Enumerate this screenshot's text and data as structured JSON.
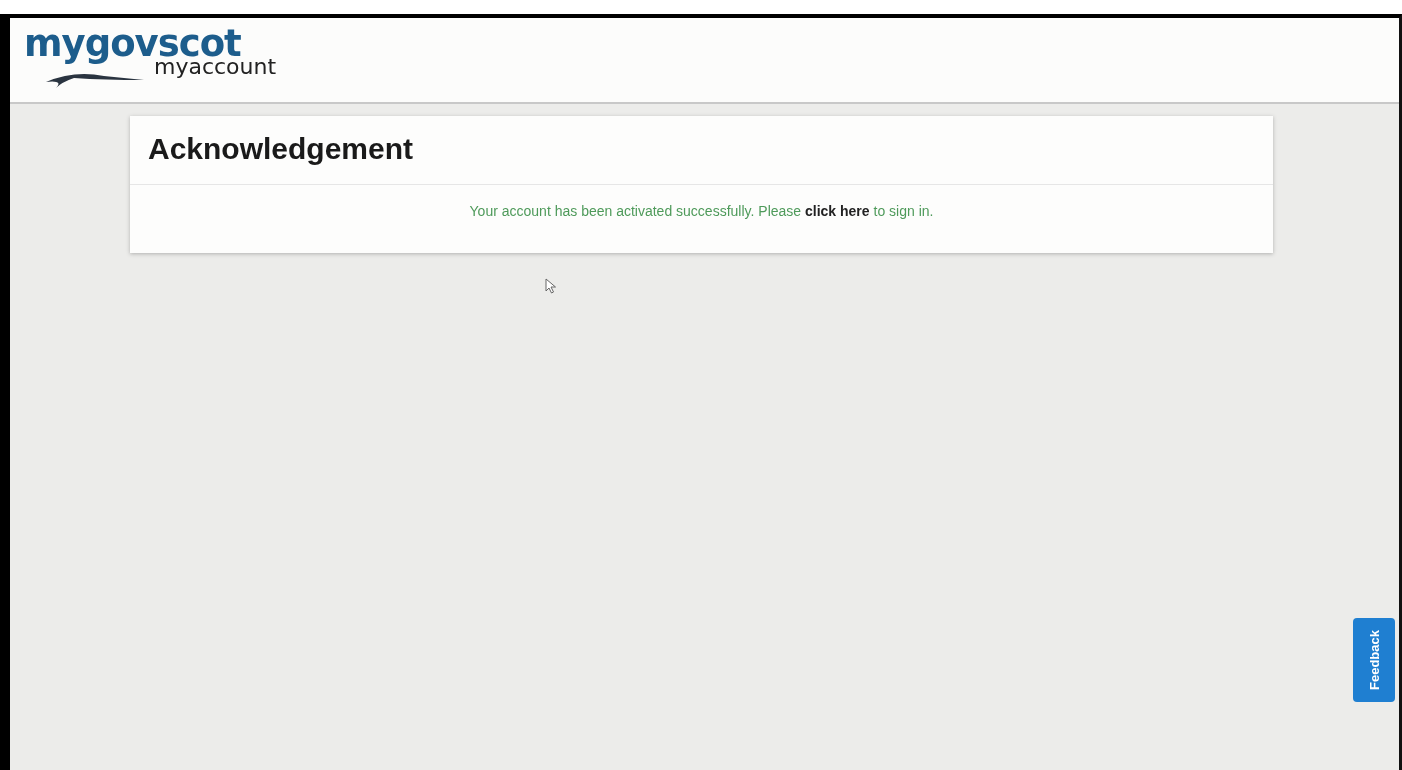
{
  "header": {
    "logo_top": "mygovscot",
    "logo_bottom": "myaccount"
  },
  "card": {
    "title": "Acknowledgement",
    "message": {
      "before": "Your account has been activated successfully. Please ",
      "link": "click here",
      "after": " to sign in."
    }
  },
  "feedback_tab": {
    "label": "Feedback"
  }
}
